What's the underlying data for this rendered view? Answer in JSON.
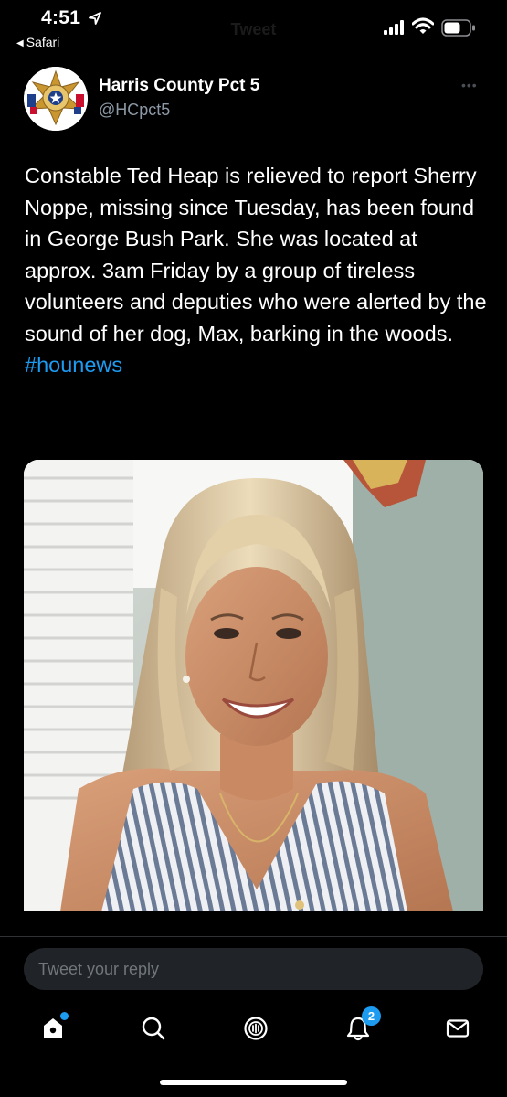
{
  "status_bar": {
    "time": "4:51",
    "back_app": "Safari",
    "ghost_title": "Tweet"
  },
  "tweet": {
    "author_name": "Harris County Pct 5",
    "author_handle": "@HCpct5",
    "text_before_hashtag": "Constable Ted Heap is relieved to report Sherry Noppe, missing since Tuesday, has been found in George Bush Park.  She was located at approx. 3am Friday by a group of tireless volunteers and deputies who were alerted by the sound of her dog, Max, barking in the woods. ",
    "hashtag": "#hounews"
  },
  "reply": {
    "placeholder": "Tweet your reply"
  },
  "tab_bar": {
    "items": [
      {
        "name": "home",
        "icon": "home-icon",
        "has_dot": true
      },
      {
        "name": "search",
        "icon": "search-icon"
      },
      {
        "name": "spaces",
        "icon": "spaces-icon"
      },
      {
        "name": "notifications",
        "icon": "bell-icon",
        "badge": "2"
      },
      {
        "name": "messages",
        "icon": "mail-icon"
      }
    ]
  },
  "colors": {
    "background": "#000000",
    "accent": "#1d9bf0",
    "secondary_text": "#8b98a5",
    "input_bg": "#202327"
  }
}
